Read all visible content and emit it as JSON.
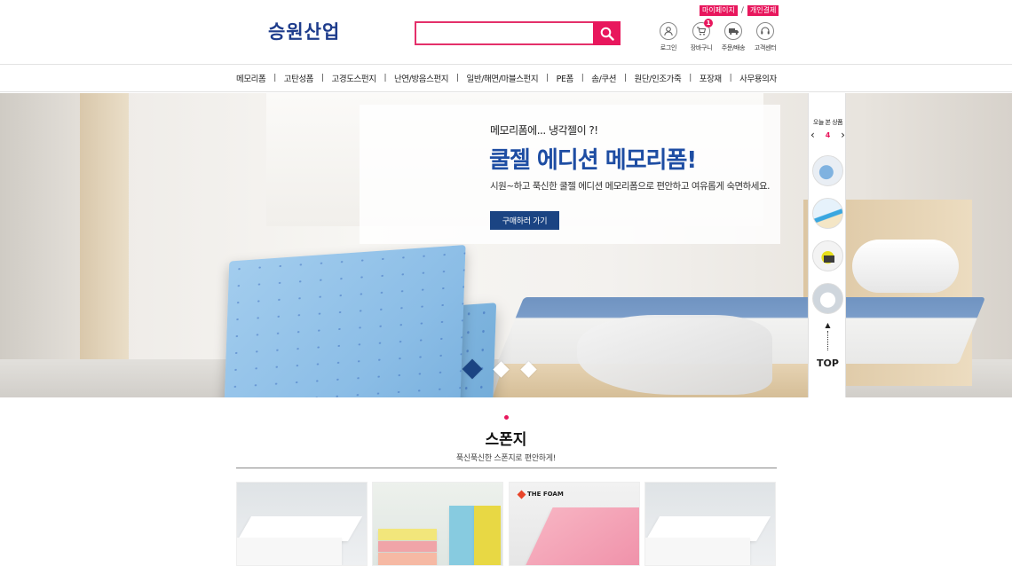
{
  "header": {
    "logo": "승원산업",
    "search_placeholder": "",
    "toplinks": [
      "마이페이지",
      "개인결제"
    ],
    "toplink_sep": "/",
    "utils": [
      {
        "label": "로그인",
        "icon": "user-icon"
      },
      {
        "label": "장바구니",
        "icon": "cart-icon",
        "badge": "1"
      },
      {
        "label": "주문/배송",
        "icon": "truck-icon"
      },
      {
        "label": "고객센터",
        "icon": "headset-icon"
      }
    ]
  },
  "nav": {
    "items": [
      "메모리폼",
      "고탄성폼",
      "고경도스펀지",
      "난연/방음스펀지",
      "일반/해면/마블스펀지",
      "PE폼",
      "솜/쿠션",
      "원단/인조가죽",
      "포장재",
      "사무용의자"
    ],
    "sep": "|"
  },
  "hero": {
    "subtitle": "메모리폼에... 냉각젤이 ?!",
    "title": "쿨젤 에디션 메모리폼!",
    "description": "시원~하고 푹신한 쿨젤 에디션 메모리폼으로 편안하고 여유롭게 숙면하세요.",
    "button": "구매하러 가기",
    "slides": 3,
    "active_slide": 1,
    "accent": "#1e4da3"
  },
  "quick": {
    "title": "오늘 본 상품",
    "page": "4",
    "prev": "‹",
    "next": "›",
    "top_arrow": "▲",
    "top_label": "TOP"
  },
  "section": {
    "title": "스폰지",
    "subtitle": "푹신푹신한 스폰지로 편안하게!",
    "cards": [
      {
        "name": "white-foam"
      },
      {
        "name": "color-foam"
      },
      {
        "name": "pink-foam",
        "brand": "THE FOAM"
      },
      {
        "name": "white-foam-2"
      }
    ]
  },
  "colors": {
    "brand": "#1e3c8c",
    "accent_pink": "#e8175d",
    "button_navy": "#1b4483"
  }
}
